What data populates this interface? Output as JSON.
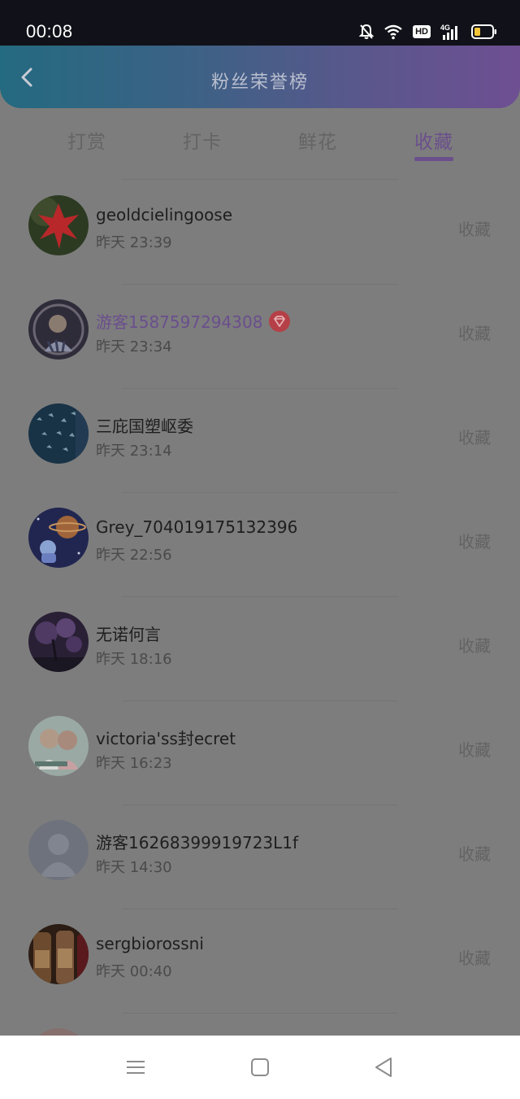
{
  "status_bar": {
    "time": "00:08",
    "hd": "HD",
    "network": "4G",
    "icons": [
      "bell-muted-icon",
      "wifi-icon",
      "hd-icon",
      "signal-4g-icon",
      "battery-icon"
    ]
  },
  "header": {
    "title": "粉丝荣誉榜",
    "back_icon": "chevron-left-icon"
  },
  "tabs": [
    {
      "label": "打赏",
      "active": false
    },
    {
      "label": "打卡",
      "active": false
    },
    {
      "label": "鲜花",
      "active": false
    },
    {
      "label": "收藏",
      "active": true
    }
  ],
  "list": [
    {
      "name": "geoldcielingoose",
      "time": "昨天 23:39",
      "action": "收藏",
      "vip": false
    },
    {
      "name": "游客1587597294308",
      "time": "昨天 23:34",
      "action": "收藏",
      "vip": true
    },
    {
      "name": "三庇国塑岖委",
      "time": "昨天 23:14",
      "action": "收藏",
      "vip": false
    },
    {
      "name": "Grey_704019175132396",
      "time": "昨天 22:56",
      "action": "收藏",
      "vip": false
    },
    {
      "name": "无诺何言",
      "time": "昨天 18:16",
      "action": "收藏",
      "vip": false
    },
    {
      "name": "victoria'ss封ecret",
      "time": "昨天 16:23",
      "action": "收藏",
      "vip": false
    },
    {
      "name": "游客16268399919723L1f",
      "time": "昨天 14:30",
      "action": "收藏",
      "vip": false
    },
    {
      "name": "sergbiorossni",
      "time": "昨天 00:40",
      "action": "收藏",
      "vip": false
    }
  ],
  "navbar": {
    "icons": [
      "menu-icon",
      "home-square-icon",
      "back-triangle-icon"
    ]
  },
  "colors": {
    "accent": "#6b4f8c",
    "header_gradient_start": "#246a80",
    "header_gradient_end": "#6e4f92",
    "vip_badge": "#b54047"
  }
}
